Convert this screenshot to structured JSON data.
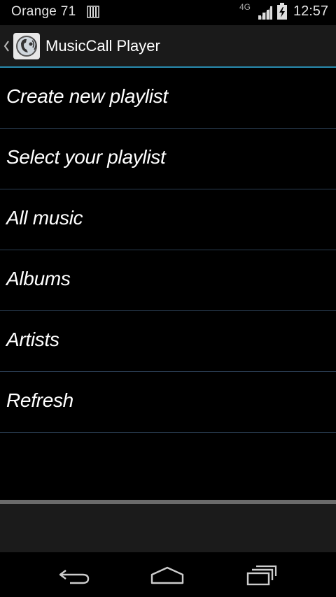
{
  "status_bar": {
    "carrier": "Orange 71",
    "network": "4G",
    "time": "12:57",
    "icons": [
      "sim-card-icon",
      "signal-icon",
      "battery-charging-icon"
    ]
  },
  "action_bar": {
    "title": "MusicCall Player",
    "icons": [
      "up-navigation-icon",
      "app-logo-icon"
    ]
  },
  "menu": {
    "items": [
      {
        "label": "Create new playlist"
      },
      {
        "label": "Select your playlist"
      },
      {
        "label": "All music"
      },
      {
        "label": "Albums"
      },
      {
        "label": "Artists"
      },
      {
        "label": "Refresh"
      }
    ]
  },
  "nav_bar": {
    "icons": [
      "back-icon",
      "home-icon",
      "recent-apps-icon"
    ]
  },
  "colors": {
    "background": "#000000",
    "action_bar": "#1a1a1a",
    "accent": "#33b5e5",
    "divider": "#2a3d52",
    "text": "#ffffff"
  }
}
